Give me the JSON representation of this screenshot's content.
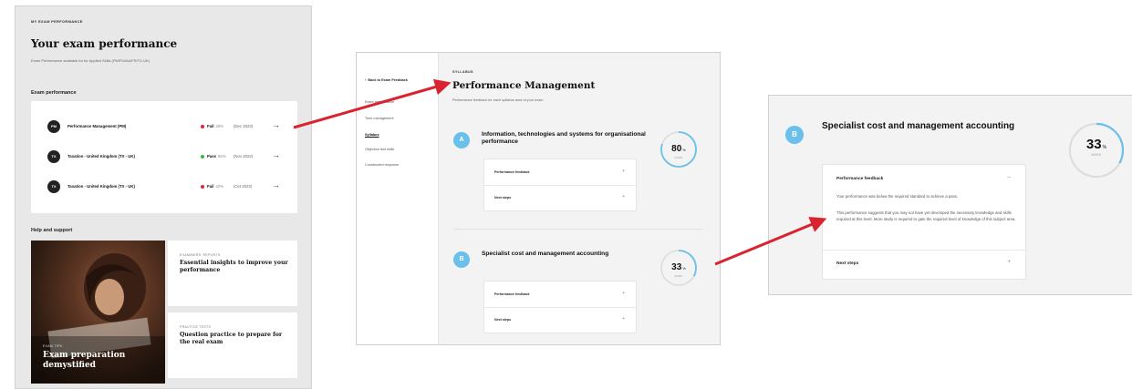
{
  "panel1": {
    "eyebrow": "MY EXAM PERFORMANCE",
    "title": "Your exam performance",
    "subtitle": "Exam Performance available for for Applied Skills (PM/FM/AA/FR/TX-UK)",
    "section_heading": "Exam performance",
    "exams": [
      {
        "badge": "PM",
        "name": "Performance Management (PM)",
        "status": "Fail",
        "percent": "33%",
        "date": "(Dec 2023)",
        "status_color": "#e0243a"
      },
      {
        "badge": "TX",
        "name": "Taxation - United Kingdom (TX - UK)",
        "status": "Pass",
        "percent": "66%",
        "date": "(Nov 2022)",
        "status_color": "#3bb54a"
      },
      {
        "badge": "TX",
        "name": "Taxation - United Kingdom (TX - UK)",
        "status": "Fail",
        "percent": "42%",
        "date": "(Oct 2022)",
        "status_color": "#e0243a"
      }
    ],
    "help_heading": "Help and support",
    "photo_card": {
      "label": "EXAM TIPS",
      "title": "Exam preparation demystified"
    },
    "tiles": [
      {
        "label": "EXAMINERS' REPORTS",
        "title": "Essential insights to improve your performance"
      },
      {
        "label": "PRACTICE TESTS",
        "title": "Question practice to prepare for the real exam"
      }
    ]
  },
  "panel2": {
    "back": "Back to Exam Feedback",
    "nav": [
      "Exam performance",
      "Time management",
      "Syllabus",
      "Objective test skills",
      "Constructed response"
    ],
    "eyebrow": "SYLLABUS",
    "title": "Performance Management",
    "subtitle": "Performance feedback for each syllabus area of your exam",
    "areas": [
      {
        "letter": "A",
        "name": "Information, technologies and systems for organisational performance",
        "score": "80",
        "unit": "%",
        "mark": "MARK",
        "score_fraction": 0.8,
        "items": [
          "Performance feedback",
          "Next steps"
        ]
      },
      {
        "letter": "B",
        "name": "Specialist cost and management accounting",
        "score": "33",
        "unit": "%",
        "mark": "MARK",
        "score_fraction": 0.33,
        "items": [
          "Performance feedback",
          "Next steps"
        ]
      }
    ]
  },
  "panel3": {
    "letter": "B",
    "name": "Specialist cost and management accounting",
    "score": "33",
    "unit": "%",
    "mark": "MARK",
    "score_fraction": 0.33,
    "feedback_label": "Performance feedback",
    "paragraph1": "Your performance was below the required standard to achieve a pass.",
    "paragraph2": "This performance suggests that you may not have yet developed the necessary knowledge and skills required at this level. More study is required to gain the required level of knowledge of this subject area.",
    "next_steps": "Next steps"
  },
  "colors": {
    "accent_blue": "#6ac0ea",
    "arrow_red": "#d9232f",
    "fail": "#e0243a",
    "pass": "#3bb54a"
  }
}
